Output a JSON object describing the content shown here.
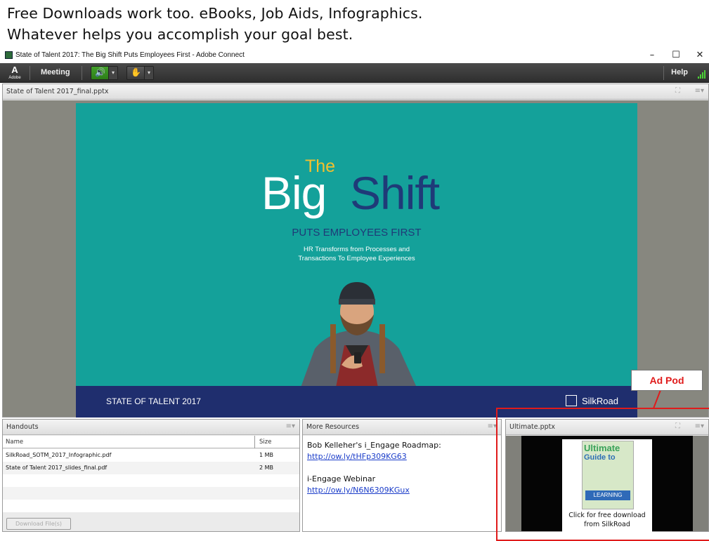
{
  "caption": {
    "line1": "Free Downloads work too.  eBooks, Job Aids, Infographics.",
    "line2": "Whatever helps you accomplish your goal best."
  },
  "window": {
    "title": "State of Talent 2017: The Big Shift Puts Employees First - Adobe Connect",
    "minimize": "–",
    "maximize": "☐",
    "close": "✕"
  },
  "menubar": {
    "logo": "A",
    "logo_sub": "Adobe",
    "meeting": "Meeting",
    "speaker_icon": "🔊",
    "raise_hand_icon": "✋",
    "dropdown": "▾",
    "help": "Help"
  },
  "share_pod": {
    "title": "State of Talent 2017_final.pptx",
    "menu": "≡▾",
    "fullscreen": "⛶",
    "slide": {
      "the": "The",
      "big": "Big",
      "shift": "Shift",
      "tagline": "PUTS EMPLOYEES FIRST",
      "sub1": "HR Transforms from Processes and",
      "sub2": "Transactions To Employee Experiences",
      "footer_left": "STATE OF TALENT 2017",
      "footer_right": "SilkRoad"
    }
  },
  "handouts_pod": {
    "title": "Handouts",
    "menu": "≡▾",
    "columns": [
      "Name",
      "Size"
    ],
    "rows": [
      {
        "name": "SilkRoad_SOTM_2017_Infographic.pdf",
        "size": "1 MB"
      },
      {
        "name": "State of Talent 2017_slides_final.pdf",
        "size": "2 MB"
      }
    ],
    "download_label": "Download File(s)"
  },
  "resources_pod": {
    "title": "More Resources",
    "menu": "≡▾",
    "item1_label": "Bob Kelleher's i_Engage Roadmap:",
    "item1_link": "http://ow.ly/tHFp309KG63",
    "item2_label": "i-Engage Webinar",
    "item2_link": "http://ow.ly/N6N6309KGux"
  },
  "ad_pod": {
    "title": "Ultimate.pptx",
    "menu": "≡▾",
    "fullscreen": "⛶",
    "book_line1": "Ultimate",
    "book_line2": "Guide to",
    "book_band": "LEARNING",
    "caption1": "Click for free download",
    "caption2": "from SilkRoad"
  },
  "callout": {
    "label": "Ad Pod",
    "color": "#e01b1b"
  },
  "colors": {
    "slide_bg": "#14a19a",
    "slide_navy": "#1f3a78",
    "slide_gold": "#f2c02e",
    "link": "#1a3cc9",
    "audio_on": "#43a02a"
  }
}
